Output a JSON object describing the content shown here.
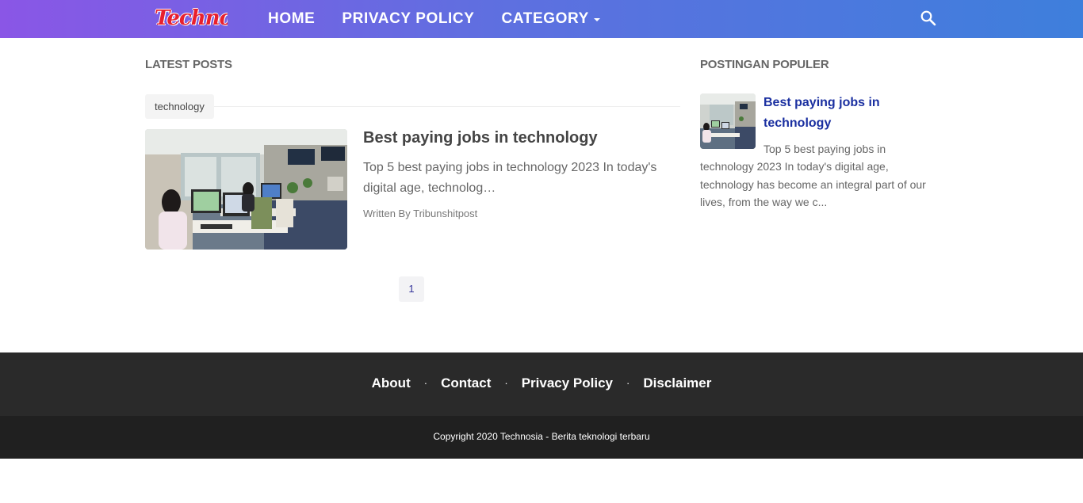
{
  "header": {
    "logo_text": "Technosia",
    "nav": [
      {
        "label": "HOME"
      },
      {
        "label": "PRIVACY POLICY"
      },
      {
        "label": "CATEGORY",
        "has_dropdown": true
      }
    ],
    "search_icon": "search-icon",
    "gradient": [
      "#8a56e6",
      "#3e7fdc"
    ]
  },
  "main": {
    "section_title": "LATEST POSTS",
    "label": "technology",
    "post": {
      "title": "Best paying jobs in technology",
      "snippet": "Top 5 best paying jobs in technology 2023 In today's digital age, technolog…",
      "byline_prefix": "Written By ",
      "author": "Tribunshitpost",
      "thumbnail": "office-workers-photo"
    },
    "pagination": {
      "current": "1"
    }
  },
  "sidebar": {
    "section_title": "POSTINGAN POPULER",
    "popular": [
      {
        "title": "Best paying jobs in technology",
        "snippet": "Top 5 best paying jobs in technology 2023 In today's digital age, technology has become an integral part of our lives, from the way we c...",
        "thumbnail": "office-workers-photo"
      }
    ]
  },
  "footer": {
    "links": [
      {
        "label": "About"
      },
      {
        "label": "Contact"
      },
      {
        "label": "Privacy Policy"
      },
      {
        "label": "Disclaimer"
      }
    ],
    "separator": "·",
    "copyright": "Copyright 2020 Technosia - Berita teknologi terbaru",
    "colors": {
      "links_bar": "#2a2a2a",
      "copyright_bar": "#202020"
    }
  },
  "colors": {
    "accent_link": "#1a2fa0",
    "logo_red": "#e8202e"
  }
}
